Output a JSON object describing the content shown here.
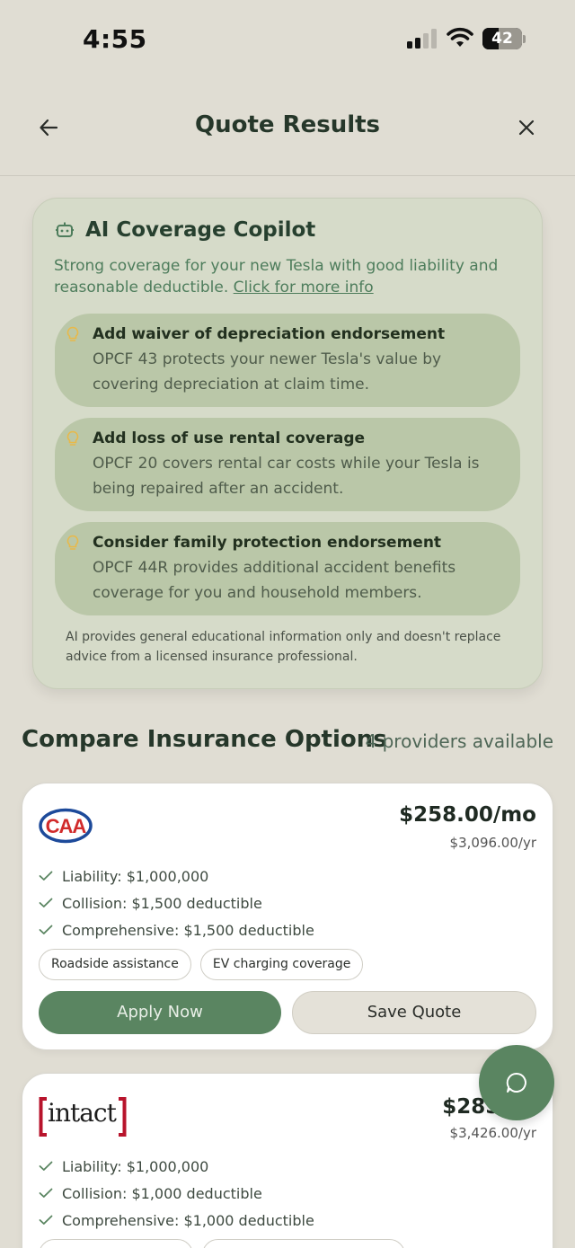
{
  "status": {
    "time": "4:55",
    "battery": "42"
  },
  "header": {
    "title": "Quote Results",
    "back_icon": "arrow-left-icon",
    "close_icon": "close-icon"
  },
  "copilot": {
    "title": "AI Coverage Copilot",
    "summary": "Strong coverage for your new Tesla with good liability and reasonable deductible.",
    "link": "Click for more info",
    "tips": [
      {
        "title": "Add waiver of depreciation endorsement",
        "body": "OPCF 43 protects your newer Tesla's value by covering depreciation at claim time."
      },
      {
        "title": "Add loss of use rental coverage",
        "body": "OPCF 20 covers rental car costs while your Tesla is being repaired after an accident."
      },
      {
        "title": "Consider family protection endorsement",
        "body": "OPCF 44R provides additional accident benefits coverage for you and household members."
      }
    ],
    "disclaimer": "AI provides general educational information only and doesn't replace advice from a licensed insurance professional."
  },
  "compare": {
    "title": "Compare Insurance Options",
    "count": "4 providers available"
  },
  "providers": [
    {
      "logo": "CAA",
      "price_month": "$258.00/mo",
      "price_year": "$3,096.00/yr",
      "features": [
        "Liability: $1,000,000",
        "Collision: $1,500 deductible",
        "Comprehensive: $1,500 deductible"
      ],
      "chips": [
        "Roadside assistance",
        "EV charging coverage"
      ],
      "apply_label": "Apply Now",
      "save_label": "Save Quote"
    },
    {
      "logo": "intact",
      "price_month": "$285.50",
      "price_year": "$3,426.00/yr",
      "features": [
        "Liability: $1,000,000",
        "Collision: $1,000 deductible",
        "Comprehensive: $1,000 deductible"
      ]
    }
  ],
  "colors": {
    "background": "#e0ddd3",
    "accent": "#5a8561",
    "copilot_bg": "#d6dbc9",
    "tip_bg": "#bac7a8",
    "bulb": "#e8b94a"
  }
}
